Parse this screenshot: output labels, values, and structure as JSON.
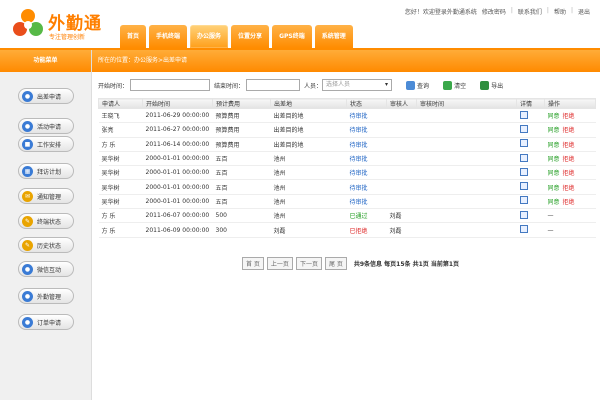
{
  "header": {
    "logo_title": "外勤通",
    "logo_slogan": "专注管理创新",
    "links": [
      "您好！欢迎登录外勤通系统",
      "修改密码",
      "联系我们",
      "帮助",
      "退出"
    ]
  },
  "nav": {
    "tabs": [
      "首页",
      "手机终端",
      "办公服务",
      "位置分享",
      "GPS终端",
      "系统管理"
    ],
    "active": 2
  },
  "sidebar": {
    "title": "功能菜单",
    "items": [
      "出差申请",
      "活动申请",
      "工作安排",
      "拜访计划",
      "通知管理",
      "终端状态",
      "历史状态",
      "微信互动",
      "外勤管理",
      "订单申请"
    ]
  },
  "breadcrumb": "所在的位置：办公服务>出差申请",
  "filter": {
    "start_label": "开始时间：",
    "end_label": "结束时间：",
    "person_label": "人员：",
    "person_placeholder": "选择人员",
    "query": "查询",
    "clear": "清空",
    "export": "导出"
  },
  "table": {
    "columns": [
      "申请人",
      "开始时间",
      "预计费用",
      "出差地",
      "状态",
      "审核人",
      "审核时间",
      "详情",
      "操作"
    ],
    "rows": [
      {
        "applicant": "王晓飞",
        "start": "2011-06-29 00:00:00",
        "cost": "预算费用",
        "place": "出差目的地",
        "status": "待审批",
        "status_type": "pending",
        "reviewer": "",
        "review_time": "",
        "ops": [
          "同意",
          "拒绝"
        ]
      },
      {
        "applicant": "张亮",
        "start": "2011-06-27 00:00:00",
        "cost": "预算费用",
        "place": "出差目的地",
        "status": "待审批",
        "status_type": "pending",
        "reviewer": "",
        "review_time": "",
        "ops": [
          "同意",
          "拒绝"
        ]
      },
      {
        "applicant": "方 乐",
        "start": "2011-06-14 00:00:00",
        "cost": "预算费用",
        "place": "出差目的地",
        "status": "待审批",
        "status_type": "pending",
        "reviewer": "",
        "review_time": "",
        "ops": [
          "同意",
          "拒绝"
        ]
      },
      {
        "applicant": "吴华树",
        "start": "2000-01-01 00:00:00",
        "cost": "五百",
        "place": "池州",
        "status": "待审批",
        "status_type": "pending",
        "reviewer": "",
        "review_time": "",
        "ops": [
          "同意",
          "拒绝"
        ]
      },
      {
        "applicant": "吴华树",
        "start": "2000-01-01 00:00:00",
        "cost": "五百",
        "place": "池州",
        "status": "待审批",
        "status_type": "pending",
        "reviewer": "",
        "review_time": "",
        "ops": [
          "同意",
          "拒绝"
        ]
      },
      {
        "applicant": "吴华树",
        "start": "2000-01-01 00:00:00",
        "cost": "五百",
        "place": "池州",
        "status": "待审批",
        "status_type": "pending",
        "reviewer": "",
        "review_time": "",
        "ops": [
          "同意",
          "拒绝"
        ]
      },
      {
        "applicant": "吴华树",
        "start": "2000-01-01 00:00:00",
        "cost": "五百",
        "place": "池州",
        "status": "待审批",
        "status_type": "pending",
        "reviewer": "",
        "review_time": "",
        "ops": [
          "同意",
          "拒绝"
        ]
      },
      {
        "applicant": "方 乐",
        "start": "2011-06-07 00:00:00",
        "cost": "500",
        "place": "池州",
        "status": "已通过",
        "status_type": "approved",
        "reviewer": "刘磊",
        "review_time": "",
        "ops": [
          "—"
        ]
      },
      {
        "applicant": "方 乐",
        "start": "2011-06-09 00:00:00",
        "cost": "300",
        "place": "刘磊",
        "status": "已拒绝",
        "status_type": "rejected",
        "reviewer": "刘磊",
        "review_time": "",
        "ops": [
          "—"
        ]
      }
    ]
  },
  "pager": {
    "first": "首 页",
    "prev": "上一页",
    "next": "下一页",
    "last": "尾 页",
    "info": "共9条信息 每页15条 共1页 当前第1页"
  },
  "colors": {
    "accent": "#ff8c00",
    "link": "#1d63c4",
    "approve": "#1a9a1a",
    "reject": "#dd2222"
  }
}
